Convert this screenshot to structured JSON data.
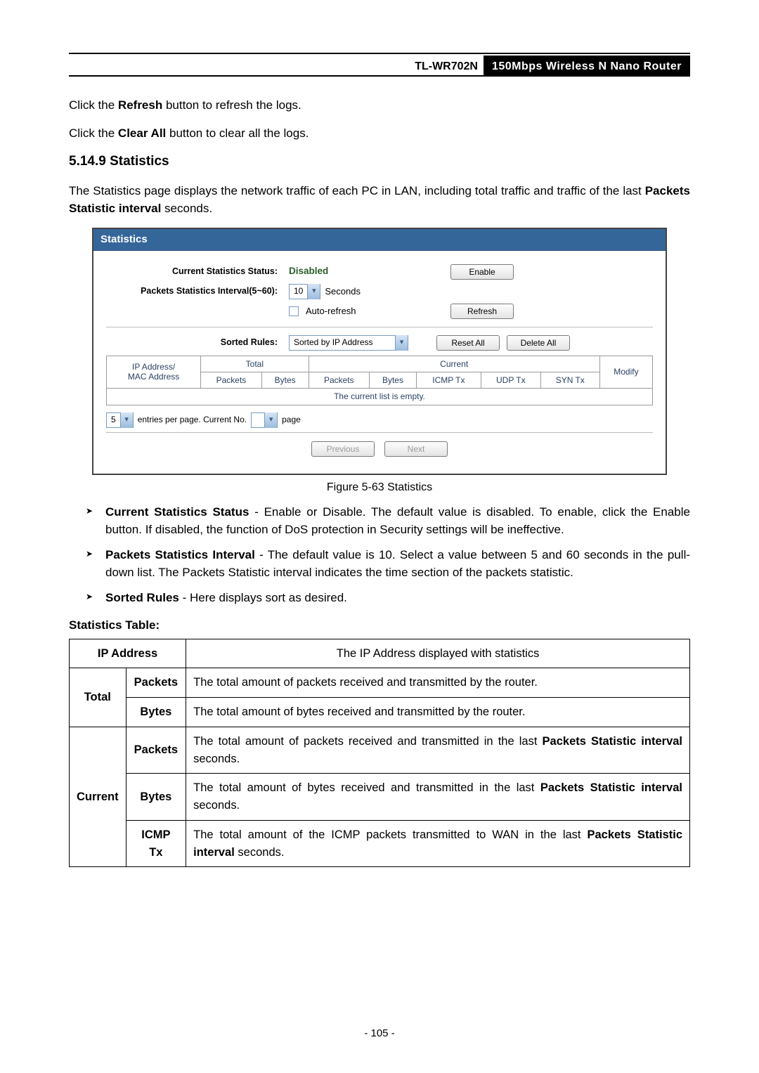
{
  "header": {
    "model": "TL-WR702N",
    "product": "150Mbps  Wireless  N  Nano  Router"
  },
  "intro": {
    "line1_a": "Click the ",
    "line1_b": "Refresh",
    "line1_c": " button to refresh the logs.",
    "line2_a": "Click the ",
    "line2_b": "Clear All",
    "line2_c": " button to clear all the logs."
  },
  "section": {
    "number_title": "5.14.9  Statistics",
    "para_a": "The Statistics page displays the network traffic of each PC in LAN, including total traffic and traffic of the last ",
    "para_b": "Packets Statistic interval",
    "para_c": " seconds."
  },
  "ui": {
    "title": "Statistics",
    "status_label": "Current Statistics Status:",
    "status_value": "Disabled",
    "enable_btn": "Enable",
    "interval_label": "Packets Statistics Interval(5~60):",
    "interval_value": "10",
    "interval_unit": "Seconds",
    "autorefresh": "Auto-refresh",
    "refresh_btn": "Refresh",
    "sorted_label": "Sorted Rules:",
    "sorted_value": "Sorted by IP Address",
    "reset_btn": "Reset All",
    "delete_btn": "Delete All",
    "th_ip": "IP Address/\nMAC Address",
    "th_total": "Total",
    "th_current": "Current",
    "th_packets": "Packets",
    "th_bytes": "Bytes",
    "th_icmp": "ICMP Tx",
    "th_udp": "UDP Tx",
    "th_syn": "SYN Tx",
    "th_modify": "Modify",
    "empty": "The current list is empty.",
    "entries_val": "5",
    "entries_text": "entries per page.  Current No.",
    "page_val": "",
    "page_text": "page",
    "prev": "Previous",
    "next": "Next"
  },
  "fig_caption": "Figure 5-63 Statistics",
  "bullets": {
    "b1_t": "Current Statistics Status",
    "b1_d": " - Enable or Disable. The default value is disabled. To enable, click the Enable button. If disabled, the function of DoS protection in Security settings will be ineffective.",
    "b2_t": "Packets Statistics Interval",
    "b2_d": " - The default value is 10. Select a value between 5 and 60 seconds in the pull-down list. The Packets Statistic interval indicates the time section of the packets statistic.",
    "b3_t": "Sorted Rules",
    "b3_d": " - Here displays sort as desired."
  },
  "stat_table_heading": "Statistics Table:",
  "stat_table": {
    "ip_label": "IP Address",
    "ip_desc": "The IP Address displayed with statistics",
    "total": "Total",
    "current": "Current",
    "packets": "Packets",
    "bytes": "Bytes",
    "icmp": "ICMP Tx",
    "d_total_packets": "The total amount of packets received and transmitted by the router.",
    "d_total_bytes": "The total amount of bytes received and transmitted by the router.",
    "d_cur_packets_a": "The total amount of packets received and transmitted in the last ",
    "d_cur_packets_b": "Packets Statistic interval",
    "d_cur_packets_c": " seconds.",
    "d_cur_bytes_a": "The total amount of bytes received and transmitted in the last ",
    "d_cur_bytes_b": "Packets Statistic interval",
    "d_cur_bytes_c": " seconds.",
    "d_cur_icmp_a": "The total amount of the ICMP packets transmitted to WAN in the last ",
    "d_cur_icmp_b": "Packets Statistic interval",
    "d_cur_icmp_c": " seconds."
  },
  "page_num": "- 105 -"
}
